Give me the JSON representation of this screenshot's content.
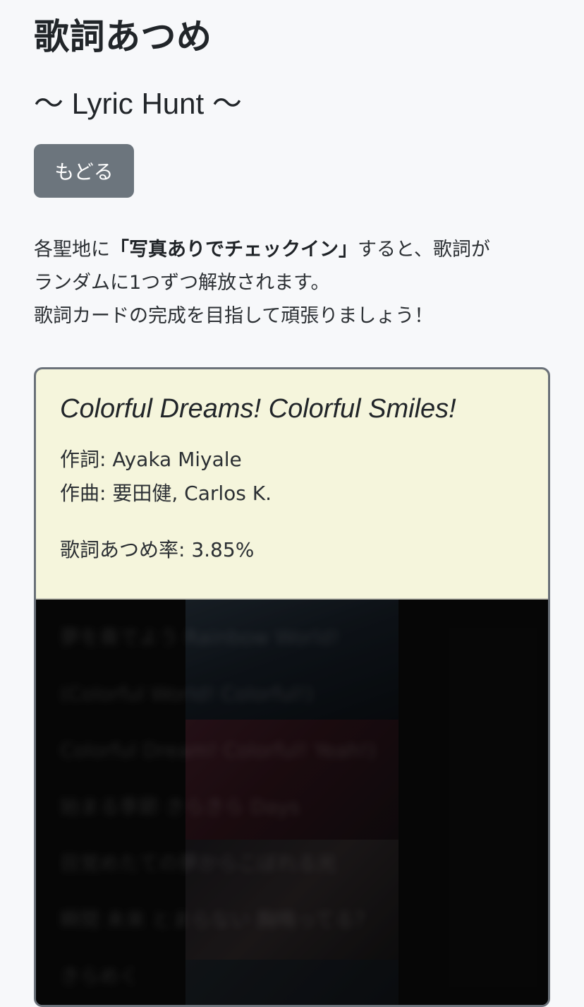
{
  "app": {
    "title": "歌詞あつめ",
    "subtitle": "〜 Lyric Hunt 〜"
  },
  "navigation": {
    "back_label": "もどる"
  },
  "intro": {
    "line1_before": "各聖地に",
    "line1_emphasis": "「写真ありでチェックイン」",
    "line1_after": "すると、歌詞が",
    "line2": "ランダムに1つずつ解放されます。",
    "line3": "歌詞カードの完成を目指して頑張りましょう！"
  },
  "song": {
    "title": "Colorful Dreams! Colorful Smiles!",
    "lyricist_label": "作詞:",
    "lyricist": "Ayaka Miyale",
    "composer_label": "作曲:",
    "composer": "要田健, Carlos K.",
    "progress_label": "歌詞あつめ率:",
    "progress_value": "3.85%"
  },
  "lyrics": {
    "locked_lines": [
      "夢を奏でよう Rainbow World!",
      "(Colorful World! Colorful!)",
      "Colorful Dream! Colorful! Yeah!)",
      "始まる季節 きらきら Days",
      "目覚めたての夢からこぼれる光",
      "瞬間 未来 とまらない 胸鳴ってる？",
      "きらめく"
    ]
  },
  "colors": {
    "page_background": "#f7f8fa",
    "button_background": "#6c757d",
    "card_header_background": "#f5f5dc",
    "card_border": "#6a7179",
    "lyrics_background": "#0b0b0b"
  }
}
